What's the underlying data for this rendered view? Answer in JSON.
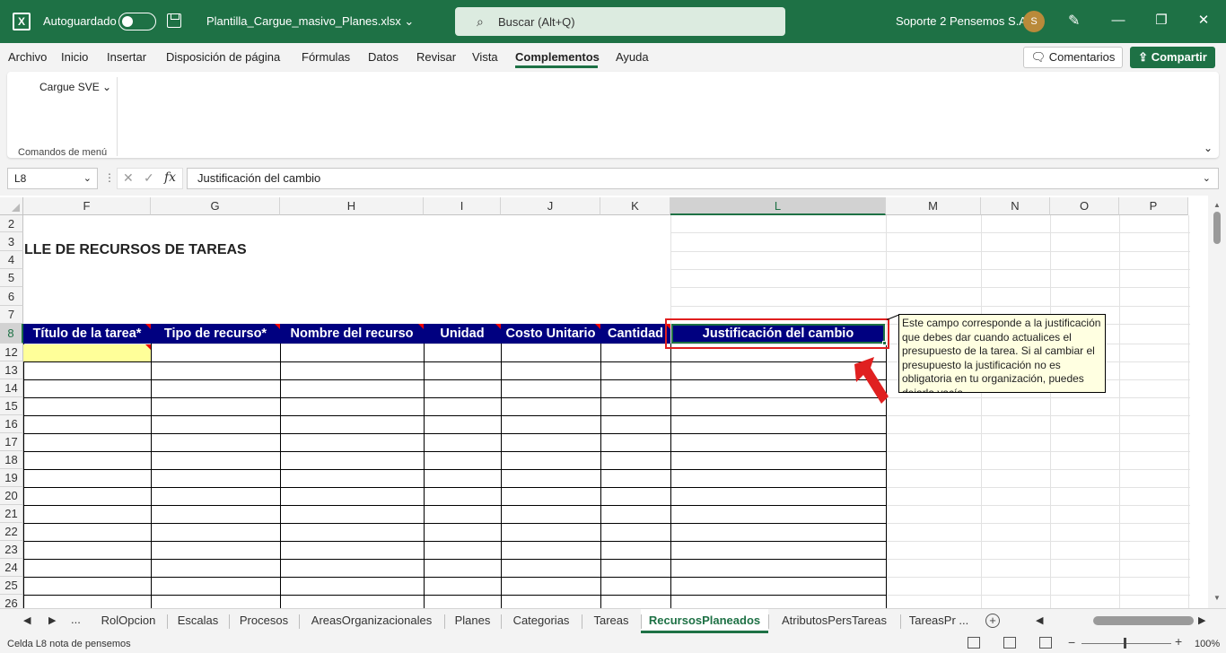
{
  "titlebar": {
    "app_logo": "X",
    "autosave_label": "Autoguardado",
    "filename": "Plantilla_Cargue_masivo_Planes.xlsx ⌄",
    "search_placeholder": "Buscar (Alt+Q)",
    "search_icon": "⌕",
    "user_name": "Soporte 2 Pensemos S.A.",
    "avatar_initial": "S",
    "pen_icon": "✎",
    "minimize": "—",
    "restore": "❐",
    "close": "✕"
  },
  "menu": {
    "tabs": [
      "Archivo",
      "Inicio",
      "Insertar",
      "Disposición de página",
      "Fórmulas",
      "Datos",
      "Revisar",
      "Vista",
      "Complementos",
      "Ayuda"
    ],
    "comments_label": "Comentarios",
    "share_label": "Compartir",
    "comments_icon": "🗨",
    "share_icon": "⇪"
  },
  "ribbon": {
    "cargue_label": "Cargue SVE ⌄",
    "group_label": "Comandos de menú",
    "collapse_icon": "⌄"
  },
  "formula_bar": {
    "name_box": "L8",
    "name_arrow": "⌄",
    "dots": "⋮",
    "cancel_icon": "✕",
    "enter_icon": "✓",
    "fx_icon": "fx",
    "value": "Justificación del cambio",
    "expand_arrow": "⌄"
  },
  "grid": {
    "columns": [
      "F",
      "G",
      "H",
      "I",
      "J",
      "K",
      "L",
      "M",
      "N",
      "O",
      "P"
    ],
    "selected_column": "L",
    "rows": [
      "2",
      "3",
      "4",
      "5",
      "6",
      "7",
      "8",
      "12",
      "13",
      "14",
      "15",
      "16",
      "17",
      "18",
      "19",
      "20",
      "21",
      "22",
      "23",
      "24",
      "25",
      "26"
    ],
    "selected_row": "8",
    "sheet_title": "LLE DE RECURSOS  DE TAREAS",
    "header_cells": [
      "Título de la tarea*",
      "Tipo de recurso*",
      "Nombre del recurso",
      "Unidad",
      "Costo Unitario",
      "Cantidad"
    ],
    "selected_cell_value": "Justificación del cambio",
    "tooltip_text": "Este campo corresponde a la justificación que debes dar cuando actualices el presupuesto de la tarea. Si al cambiar el presupuesto la justificación no es obligatoria en tu organización, puedes dejarla vacía",
    "scroll_up": "▲",
    "scroll_down": "▼"
  },
  "sheets": {
    "nav_prev": "◀",
    "nav_next": "▶",
    "nav_more": "...",
    "tabs": [
      "RolOpcion",
      "Escalas",
      "Procesos",
      "AreasOrganizacionales",
      "Planes",
      "Categorias",
      "Tareas",
      "RecursosPlaneados",
      "AtributosPersTareas",
      "TareasPr ..."
    ],
    "active": "RecursosPlaneados",
    "add_icon": "+",
    "scroll_left": "◀",
    "scroll_right": "▶"
  },
  "status": {
    "text": "Celda L8 nota de pensemos",
    "zoom_minus": "−",
    "zoom_plus": "+",
    "zoom": "100%"
  },
  "colors": {
    "excel_green": "#1e7145",
    "header_navy": "#000080",
    "highlight_red": "#e02020",
    "input_yellow": "#ffff99",
    "tooltip_bg": "#ffffe1"
  }
}
